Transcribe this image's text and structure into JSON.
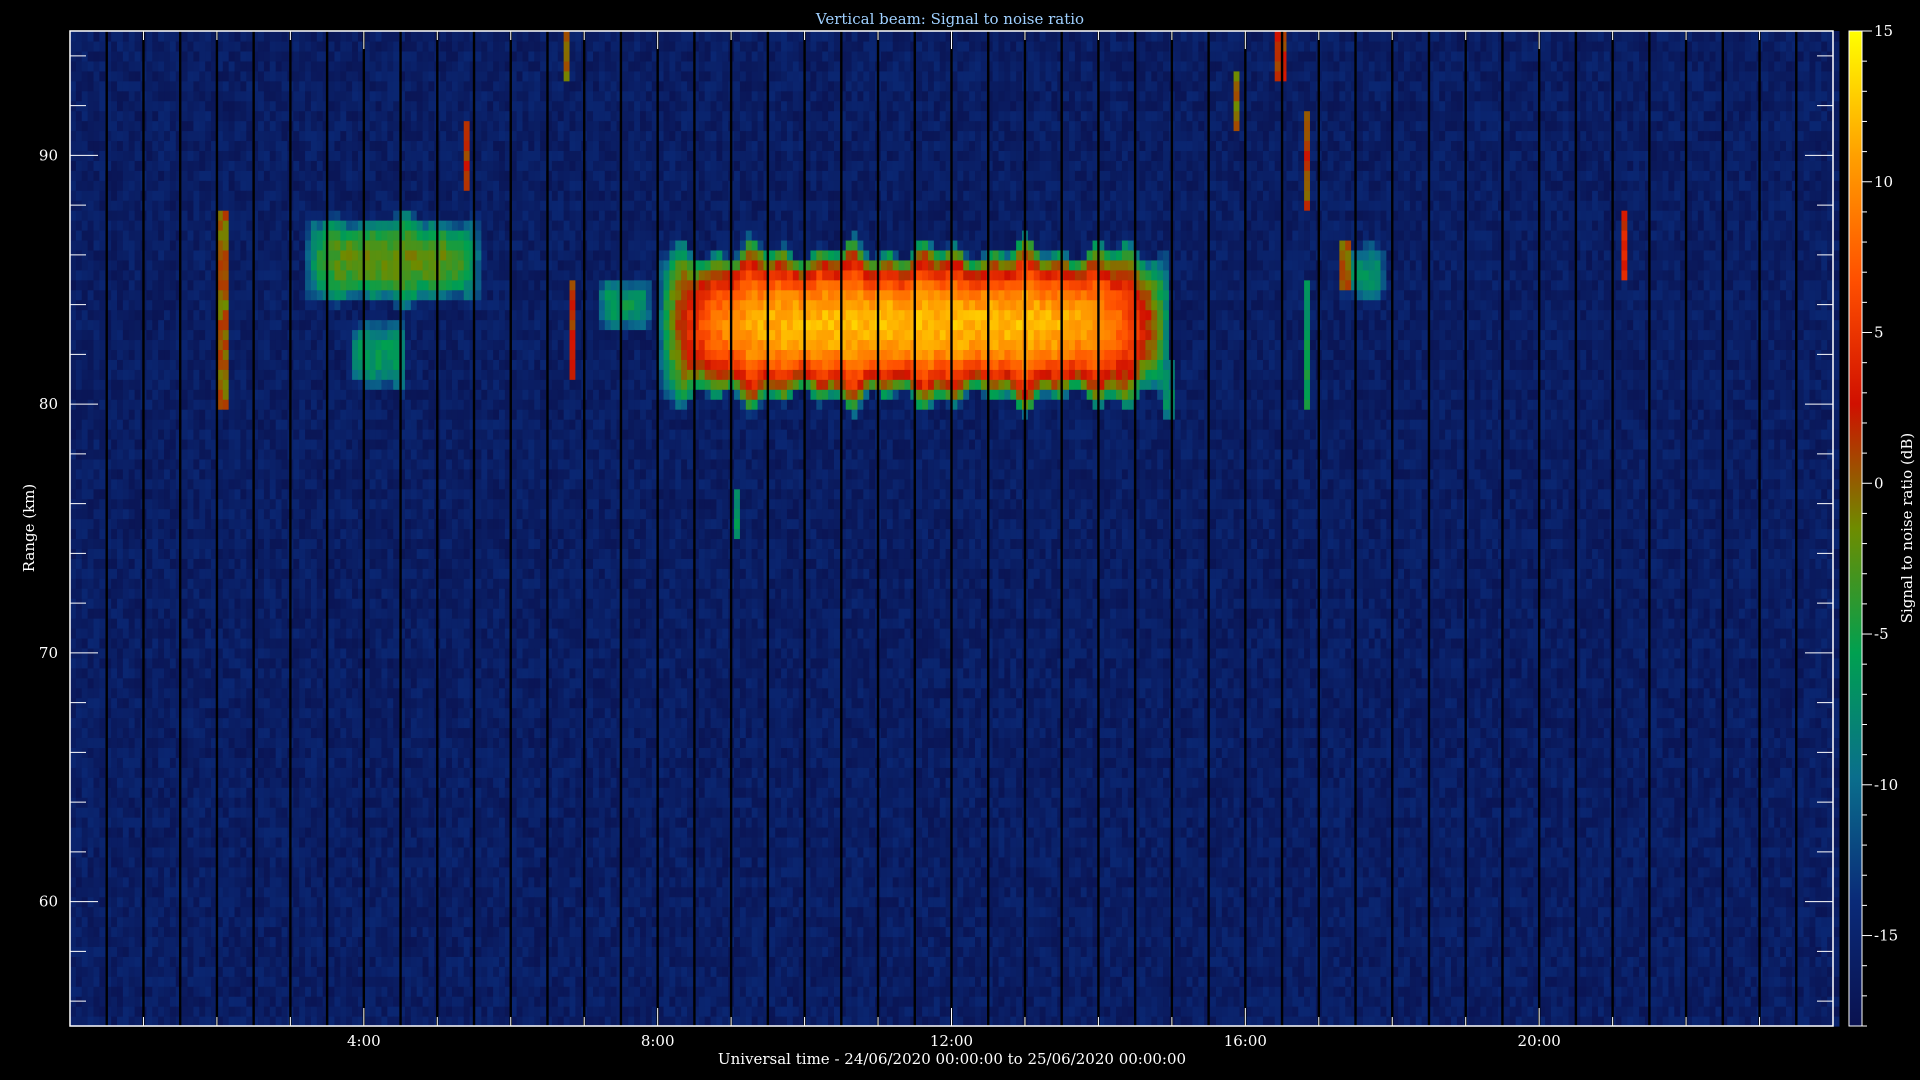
{
  "chart_data": {
    "type": "heatmap",
    "title": "Vertical beam: Signal to noise ratio",
    "xlabel": "Universal time - 24/06/2020 00:00:00 to 25/06/2020 00:00:00",
    "ylabel": "Range (km)",
    "colorbar_label": "Signal to noise ratio (dB)",
    "x_unit": "hours UT",
    "xlim": [
      0,
      24
    ],
    "ylim": [
      55,
      95
    ],
    "clim": [
      -18,
      15
    ],
    "x_ticks": [
      {
        "value": 4,
        "label": "4:00"
      },
      {
        "value": 8,
        "label": "8:00"
      },
      {
        "value": 12,
        "label": "12:00"
      },
      {
        "value": 16,
        "label": "16:00"
      },
      {
        "value": 20,
        "label": "20:00"
      }
    ],
    "y_ticks": [
      {
        "value": 60,
        "label": "60"
      },
      {
        "value": 70,
        "label": "70"
      },
      {
        "value": 80,
        "label": "80"
      },
      {
        "value": 90,
        "label": "90"
      }
    ],
    "colorbar_ticks": [
      {
        "value": 15,
        "label": "15"
      },
      {
        "value": 10,
        "label": "10"
      },
      {
        "value": 5,
        "label": "5"
      },
      {
        "value": 0,
        "label": "0"
      },
      {
        "value": -5,
        "label": "-5"
      },
      {
        "value": -10,
        "label": "-10"
      },
      {
        "value": -15,
        "label": "-15"
      }
    ],
    "background_snr": -16,
    "data_gap_interval_hours": 0.5,
    "colors": {
      "background": "#000000",
      "title": "#9fd0ff",
      "text": "#ffffff",
      "axis": "#ffffff",
      "colormap": [
        "#0a1250",
        "#0a2a78",
        "#0a6e8c",
        "#00a050",
        "#6e8c00",
        "#d01000",
        "#ff5000",
        "#ffa000",
        "#ffff00"
      ]
    },
    "echo_regions": [
      {
        "name": "main-pmse",
        "t_start": 8.0,
        "t_end": 15.0,
        "range_center": 83.2,
        "range_halfwidth": 2.8,
        "peak_snr": 12
      },
      {
        "name": "early-patch-upper",
        "t_start": 3.2,
        "t_end": 5.6,
        "range_center": 85.8,
        "range_halfwidth": 1.6,
        "peak_snr": -2
      },
      {
        "name": "early-patch-lower",
        "t_start": 3.8,
        "t_end": 4.6,
        "range_center": 82.0,
        "range_halfwidth": 1.3,
        "peak_snr": -6
      },
      {
        "name": "patch-near-7h",
        "t_start": 7.2,
        "t_end": 7.9,
        "range_center": 84.0,
        "range_halfwidth": 1.0,
        "peak_snr": -6
      },
      {
        "name": "patch-near-17h",
        "t_start": 17.3,
        "t_end": 17.9,
        "range_center": 85.3,
        "range_halfwidth": 1.0,
        "peak_snr": -7
      }
    ],
    "spikes": [
      {
        "t": 2.1,
        "r_min": 80,
        "r_max": 88,
        "snr": 0
      },
      {
        "t": 5.4,
        "r_min": 88.5,
        "r_max": 91.5,
        "snr": 2
      },
      {
        "t": 6.75,
        "r_min": 93,
        "r_max": 95,
        "snr": 0
      },
      {
        "t": 6.85,
        "r_min": 81,
        "r_max": 85,
        "snr": 2
      },
      {
        "t": 9.1,
        "r_min": 74.5,
        "r_max": 76.5,
        "snr": -7
      },
      {
        "t": 15.9,
        "r_min": 91,
        "r_max": 93.5,
        "snr": 0
      },
      {
        "t": 16.85,
        "r_min": 88,
        "r_max": 92,
        "snr": 1
      },
      {
        "t": 16.85,
        "r_min": 80,
        "r_max": 85,
        "snr": -6
      },
      {
        "t": 16.5,
        "r_min": 93,
        "r_max": 95,
        "snr": 2
      },
      {
        "t": 17.35,
        "r_min": 84.5,
        "r_max": 86.5,
        "snr": 0
      },
      {
        "t": 21.15,
        "r_min": 85,
        "r_max": 88,
        "snr": 3
      },
      {
        "t": 14.95,
        "r_min": 79.5,
        "r_max": 82,
        "snr": -8
      }
    ]
  }
}
